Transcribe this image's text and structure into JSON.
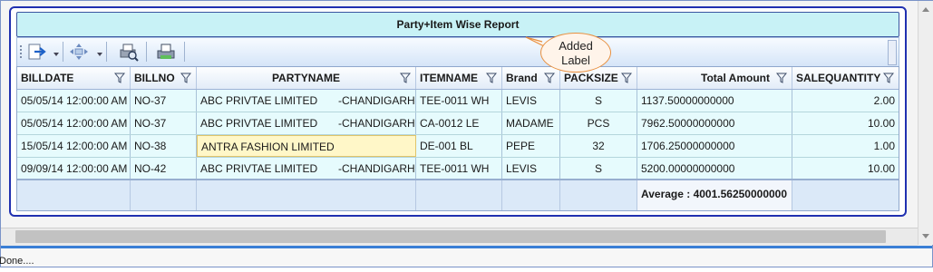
{
  "report": {
    "title": "Party+Item Wise Report"
  },
  "callout": {
    "line1": "Added",
    "line2": "Label"
  },
  "toolbar": {
    "buttons": [
      "export-icon",
      "move-icon",
      "print-preview-icon",
      "print-icon"
    ]
  },
  "grid": {
    "columns": [
      "BILLDATE",
      "BILLNO",
      "PARTYNAME",
      "ITEMNAME",
      "Brand",
      "PACKSIZE",
      "Total Amount",
      "SALEQUANTITY"
    ],
    "rows": [
      {
        "billdate": "05/05/14 12:00:00 AM",
        "billno": "NO-37",
        "party": "ABC PRIVTAE LIMITED",
        "party_loc": "-CHANDIGARH",
        "item": "TEE-0011 WH",
        "brand": "LEVIS",
        "pack": "S",
        "amount": "1137.50000000000",
        "qty": "2.00"
      },
      {
        "billdate": "05/05/14 12:00:00 AM",
        "billno": "NO-37",
        "party": "ABC PRIVTAE LIMITED",
        "party_loc": "-CHANDIGARH",
        "item": "CA-0012 LE",
        "brand": "MADAME",
        "pack": "PCS",
        "amount": "7962.50000000000",
        "qty": "10.00"
      },
      {
        "billdate": "15/05/14 12:00:00 AM",
        "billno": "NO-38",
        "party": "ANTRA FASHION LIMITED",
        "party_loc": "",
        "item": "DE-001 BL",
        "brand": "PEPE",
        "pack": "32",
        "amount": "1706.25000000000",
        "qty": "1.00"
      },
      {
        "billdate": "09/09/14 12:00:00 AM",
        "billno": "NO-42",
        "party": "ABC PRIVTAE LIMITED",
        "party_loc": "-CHANDIGARH",
        "item": "TEE-0011 WH",
        "brand": "LEVIS",
        "pack": "S",
        "amount": "5200.00000000000",
        "qty": "10.00"
      }
    ],
    "summary": "Average : 4001.56250000000"
  },
  "status": {
    "text": "Done...."
  },
  "colors": {
    "title_bg": "#c8f2f6",
    "row_bg": "#e6fbfd",
    "panel_border": "#2030b0",
    "callout_border": "#e89040",
    "status_line": "#3a7fd5"
  }
}
